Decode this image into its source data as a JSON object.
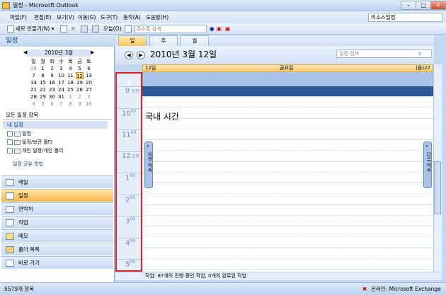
{
  "window": {
    "title": "일정 - Microsoft Outlook",
    "min": "–",
    "max": "□",
    "close": "✕"
  },
  "menu": [
    "파일(F)",
    "편집(E)",
    "보기(V)",
    "이동(G)",
    "도구(T)",
    "동작(A)",
    "도움말(H)"
  ],
  "resource_box": "리소스일정",
  "toolbar": {
    "new": "새로 만들기(N) ▾",
    "today": "오늘(O)",
    "addressbook_placeholder": "주소록 검색"
  },
  "left_header": "일정",
  "mini_cal": {
    "month_label": "2010년 3월",
    "days_header": [
      "일",
      "월",
      "화",
      "수",
      "목",
      "금",
      "토"
    ],
    "weeks": [
      [
        "28",
        "1",
        "2",
        "3",
        "4",
        "5",
        "6"
      ],
      [
        "7",
        "8",
        "9",
        "10",
        "11",
        "12",
        "13"
      ],
      [
        "14",
        "15",
        "16",
        "17",
        "18",
        "19",
        "20"
      ],
      [
        "21",
        "22",
        "23",
        "24",
        "25",
        "26",
        "27"
      ],
      [
        "28",
        "29",
        "30",
        "31",
        "1",
        "2",
        "3"
      ],
      [
        "4",
        "5",
        "6",
        "7",
        "8",
        "9",
        "10"
      ]
    ],
    "today": "12"
  },
  "all_items": "모든 일정 항목",
  "my_calendars": "내 일정",
  "calendars": [
    "일정",
    "일정/보관 폴더",
    "개인 일정/개인 폴더"
  ],
  "share_link": "일정 공유 방법",
  "nav_buttons": [
    "메일",
    "일정",
    "연락처",
    "작업",
    "메모",
    "폴더 목록",
    "바로 가기"
  ],
  "view_tabs": [
    "일",
    "주",
    "월"
  ],
  "date_title": "2010년 3월 12일",
  "search_placeholder": "일정 검색",
  "day_header": {
    "left": "12일",
    "center": "금요일",
    "right": "(음)27"
  },
  "time_labels": [
    "9",
    "10",
    "11",
    "12",
    "1",
    "2",
    "3",
    "4",
    "5"
  ],
  "ampm": {
    "am": "오전",
    "pm": "오후"
  },
  "minutes": "00",
  "event_text": "국내 시간",
  "sidebar_prev": "이전 약속",
  "sidebar_next": "다음 약속",
  "tasks_bar": "작업: 87개의 진행 중인 작업, 0개의 완료된 작업",
  "status_left": "5579개 항목",
  "status_right": "온라인: Microsoft Exchange"
}
